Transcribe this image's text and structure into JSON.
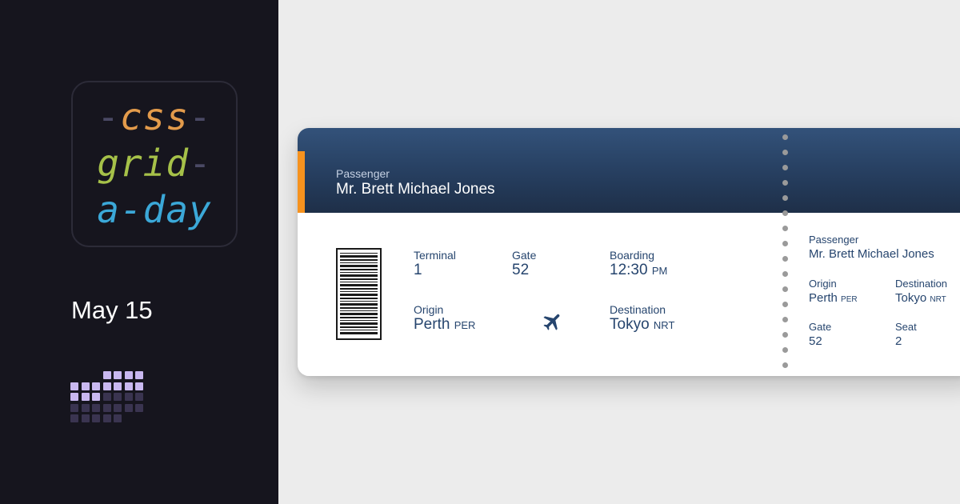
{
  "brand": {
    "logo_lines": [
      {
        "pre": "-",
        "word": "css",
        "post": "-"
      },
      {
        "pre": "",
        "word": "grid",
        "post": "-"
      },
      {
        "pre": "",
        "word": "a-day",
        "post": ""
      }
    ],
    "date": "May 15",
    "calendar_icon": "calendar-grid-icon",
    "colors": {
      "css": "#e39b4b",
      "grid": "#a6c149",
      "aday": "#3ba8d8",
      "calendar_active": "#c9b8f0",
      "calendar_inactive": "#3a3450"
    }
  },
  "ticket": {
    "header": {
      "passenger_label": "Passenger",
      "passenger_name": "Mr. Brett Michael Jones"
    },
    "main": {
      "terminal_label": "Terminal",
      "terminal_value": "1",
      "gate_label": "Gate",
      "gate_value": "52",
      "boarding_label": "Boarding",
      "boarding_time": "12:30",
      "boarding_ampm": "PM",
      "origin_label": "Origin",
      "origin_city": "Perth",
      "origin_code": "PER",
      "destination_label": "Destination",
      "destination_city": "Tokyo",
      "destination_code": "NRT",
      "plane_icon": "airplane-icon",
      "barcode_icon": "barcode-icon"
    },
    "stub": {
      "passenger_label": "Passenger",
      "passenger_name": "Mr. Brett Michael Jones",
      "origin_label": "Origin",
      "origin_city": "Perth",
      "origin_code": "PER",
      "destination_label": "Destination",
      "destination_city": "Tokyo",
      "destination_code": "NRT",
      "gate_label": "Gate",
      "gate_value": "52",
      "seat_label": "Seat",
      "seat_value": "2"
    },
    "colors": {
      "accent": "#f6921e",
      "header": "#263e5f",
      "text": "#26456e"
    }
  }
}
